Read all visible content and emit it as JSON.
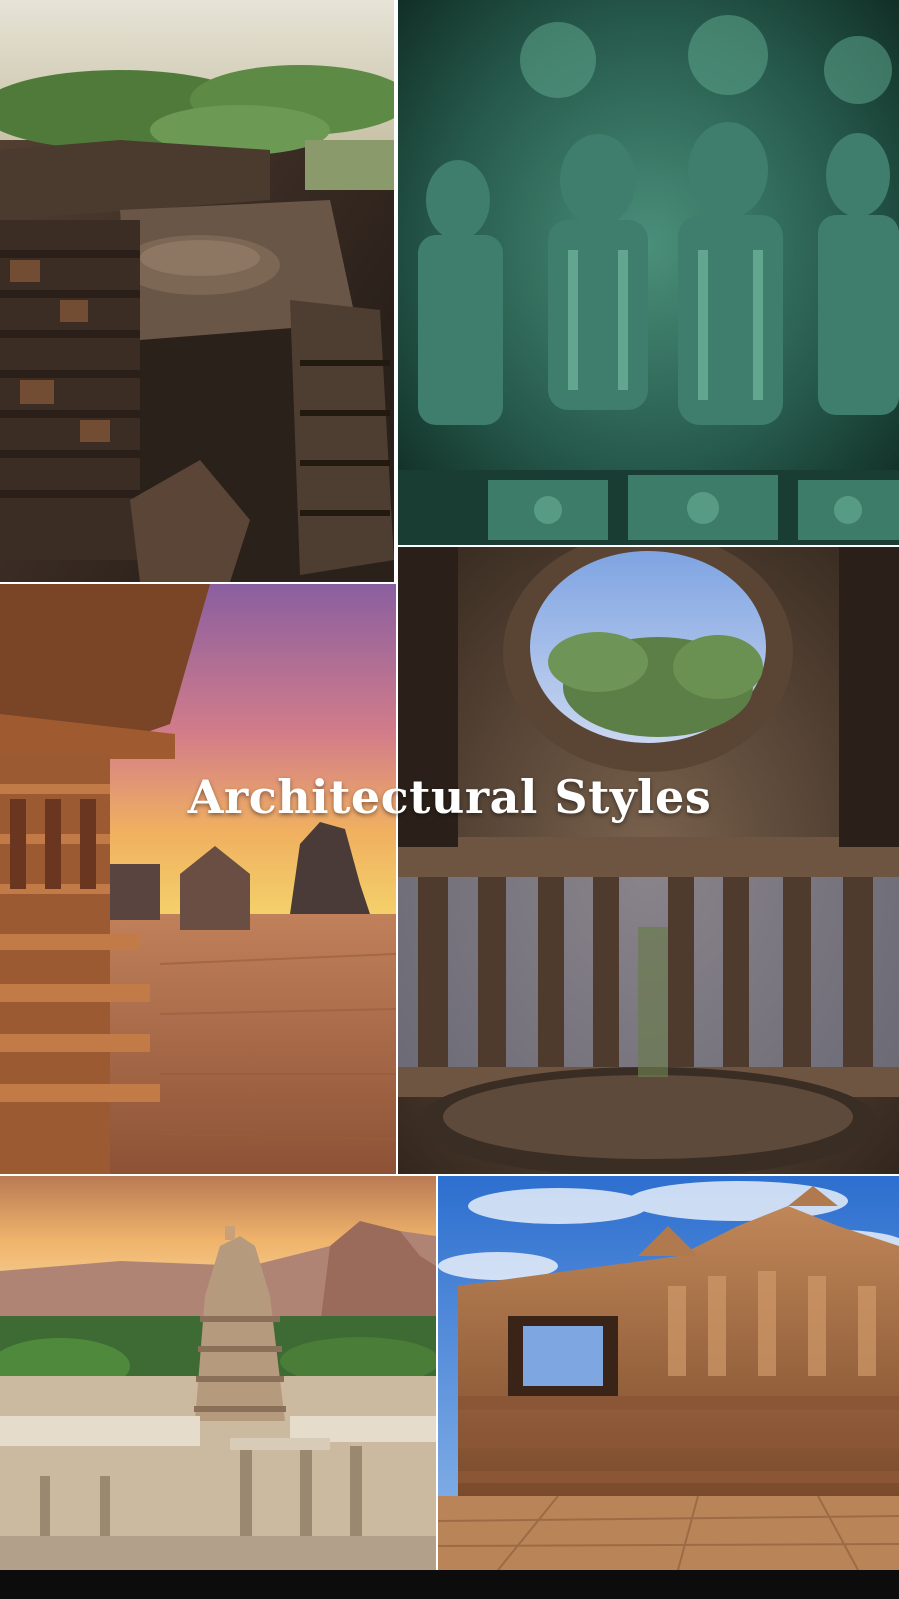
{
  "collage": {
    "title": "Architectural Styles"
  },
  "palette": {
    "stone_warm": "#b9784a",
    "stone_dark": "#3a2a22",
    "stone_green": "#3f7e6c",
    "sky_sunset": "#d98a6a",
    "sky_blue": "#3f7fd6",
    "foliage": "#4f7a3a"
  }
}
